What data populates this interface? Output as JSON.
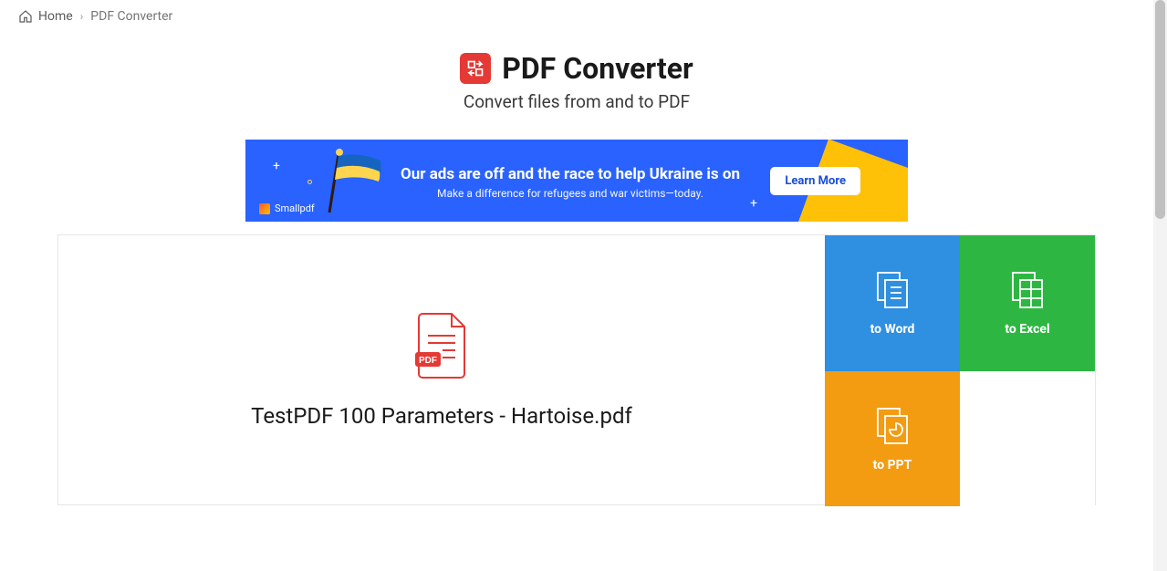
{
  "breadcrumb": {
    "home_label": "Home",
    "separator": "›",
    "current": "PDF Converter"
  },
  "header": {
    "title": "PDF Converter",
    "subtitle": "Convert files from and to PDF"
  },
  "banner": {
    "headline": "Our ads are off and the race to help Ukraine is on",
    "subtext": "Make a difference for refugees and war victims—today.",
    "button": "Learn More",
    "brand": "Smallpdf"
  },
  "file": {
    "name": "TestPDF 100 Parameters - Hartoise.pdf",
    "badge": "PDF"
  },
  "options": {
    "word": "to Word",
    "excel": "to Excel",
    "ppt": "to PPT"
  }
}
